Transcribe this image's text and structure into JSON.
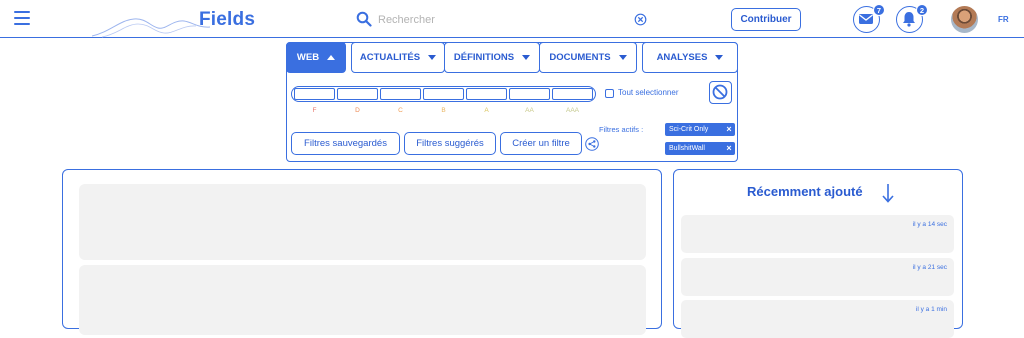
{
  "header": {
    "brand": "Fields",
    "search_placeholder": "Rechercher",
    "contribute_label": "Contribuer",
    "mail_count": "7",
    "notification_count": "2",
    "language": "FR"
  },
  "tabs": [
    {
      "label": "WEB",
      "active": true
    },
    {
      "label": "ACTUALITÉS",
      "active": false
    },
    {
      "label": "DÉFINITIONS",
      "active": false
    },
    {
      "label": "DOCUMENTS",
      "active": false
    },
    {
      "label": "ANALYSES",
      "active": false
    }
  ],
  "grades": [
    {
      "label": "F",
      "color": "#e8746a"
    },
    {
      "label": "D",
      "color": "#ec8a55"
    },
    {
      "label": "C",
      "color": "#f0a05a"
    },
    {
      "label": "B",
      "color": "#e9b45e"
    },
    {
      "label": "A",
      "color": "#d9c35a"
    },
    {
      "label": "AA",
      "color": "#c9c98a"
    },
    {
      "label": "AAA",
      "color": "#c4c98f"
    }
  ],
  "filters": {
    "select_all_label": "Tout selectionner",
    "saved_label": "Filtres sauvegardés",
    "suggested_label": "Filtres suggérés",
    "create_label": "Créer un filtre",
    "active_label": "Filtres actifs :",
    "active_chips": [
      "Sci-Crit Only",
      "BullshitWall"
    ]
  },
  "recent": {
    "title": "Récemment ajouté",
    "items": [
      {
        "time": "il y a 14 sec"
      },
      {
        "time": "il y a 21 sec"
      },
      {
        "time": "il y a 1 min"
      }
    ]
  },
  "colors": {
    "accent": "#3a6fe0",
    "placeholder_bg": "#f2f2f2"
  }
}
